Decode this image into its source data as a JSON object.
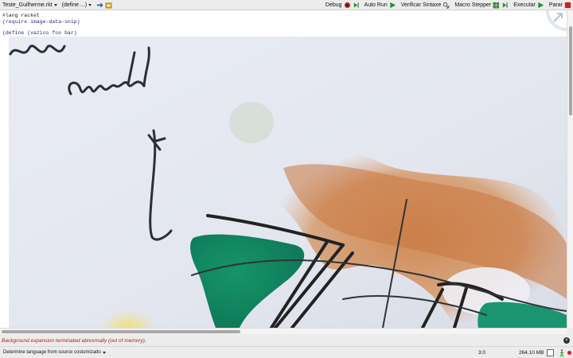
{
  "toolbar": {
    "file_menu": "Teste_Guilherme.rkt",
    "define_menu": "(define ...)",
    "buttons": [
      {
        "label": "Debug",
        "icon": "bug-icon"
      },
      {
        "label": "Auto Run",
        "icon": "play-icon"
      },
      {
        "label": "Verificar Sintaxe",
        "icon": "magnifier-check-icon"
      },
      {
        "label": "Macro Stepper",
        "icon": "stepper-icon"
      },
      {
        "label": "Executar",
        "icon": "run-icon"
      },
      {
        "label": "Parar",
        "icon": "stop-icon"
      }
    ]
  },
  "editor": {
    "lines": [
      "#lang racket",
      "(require image-data-snip)",
      "(define (vazios foo bar)"
    ]
  },
  "messages": {
    "error": "Background expansion terminated abnormally (out of memory)."
  },
  "status": {
    "language_selector": "Determine language from source costumizado",
    "position": "3:0",
    "memory": "264.10 MB"
  },
  "colors": {
    "error_text": "#b0201a",
    "keyword_blue": "#2a2a8c",
    "run_green": "#1f8f2a",
    "stop_red": "#d0201a"
  }
}
